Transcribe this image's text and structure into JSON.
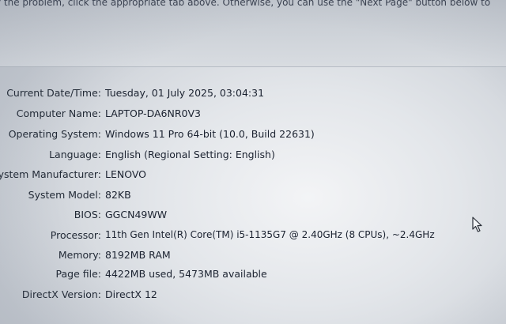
{
  "intro": {
    "text": "y the problem, click the appropriate tab above.  Otherwise, you can use the \"Next Page\" button below to"
  },
  "system_info": [
    {
      "label": "Current Date/Time:",
      "value": "Tuesday, 01 July 2025, 03:04:31"
    },
    {
      "label": "Computer Name:",
      "value": "LAPTOP-DA6NR0V3"
    },
    {
      "label": "Operating System:",
      "value": "Windows 11 Pro 64-bit (10.0, Build 22631)"
    },
    {
      "label": "Language:",
      "value": "English (Regional Setting: English)"
    },
    {
      "label": "ystem Manufacturer:",
      "value": "LENOVO"
    },
    {
      "label": "System Model:",
      "value": "82KB"
    },
    {
      "label": "BIOS:",
      "value": "GGCN49WW"
    },
    {
      "label": "Processor:",
      "value": "11th Gen Intel(R) Core(TM) i5-1135G7 @ 2.40GHz (8 CPUs), ~2.4GHz"
    },
    {
      "label": "Memory:",
      "value": "8192MB RAM"
    },
    {
      "label": "Page file:",
      "value": "4422MB used, 5473MB available"
    },
    {
      "label": "DirectX Version:",
      "value": "DirectX 12"
    }
  ],
  "cursor": {
    "icon": "mouse-pointer-icon"
  }
}
